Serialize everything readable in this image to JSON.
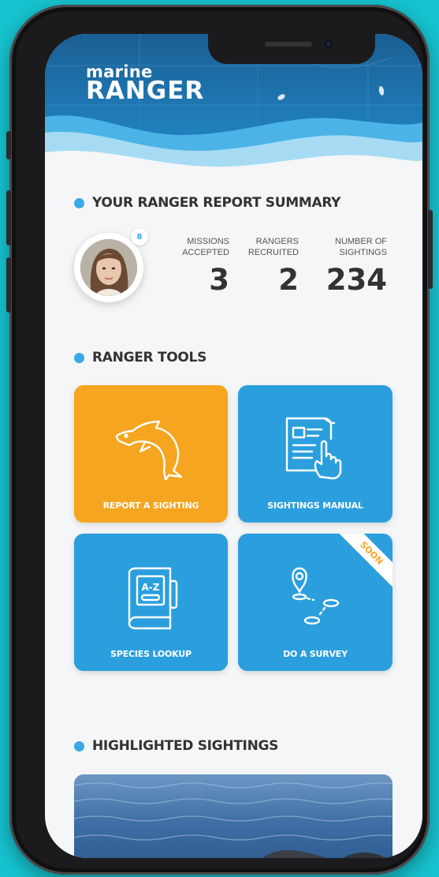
{
  "app": {
    "logo_line1": "marine",
    "logo_line2": "RANGER"
  },
  "summary": {
    "title": "YOUR RANGER REPORT SUMMARY",
    "badge_count": "8",
    "stats": [
      {
        "label": "MISSIONS\nACCEPTED",
        "value": "3"
      },
      {
        "label": "RANGERS\nRECRUITED",
        "value": "2"
      },
      {
        "label": "NUMBER OF\nSIGHTINGS",
        "value": "234"
      }
    ]
  },
  "tools": {
    "title": "RANGER TOOLS",
    "items": [
      {
        "label": "REPORT A SIGHTING",
        "icon": "dolphin-icon",
        "color": "#f5a51f"
      },
      {
        "label": "SIGHTINGS MANUAL",
        "icon": "manual-touch-icon",
        "color": "#2b9fde"
      },
      {
        "label": "SPECIES LOOKUP",
        "icon": "az-book-icon",
        "color": "#2b9fde"
      },
      {
        "label": "DO A SURVEY",
        "icon": "route-pin-icon",
        "color": "#2b9fde",
        "ribbon": "SOON"
      }
    ]
  },
  "highlights": {
    "title": "HIGHLIGHTED SIGHTINGS"
  },
  "colors": {
    "accent_blue": "#2b9fde",
    "accent_orange": "#f5a51f",
    "header_blue": "#1f6fa3",
    "text_dark": "#333333"
  }
}
